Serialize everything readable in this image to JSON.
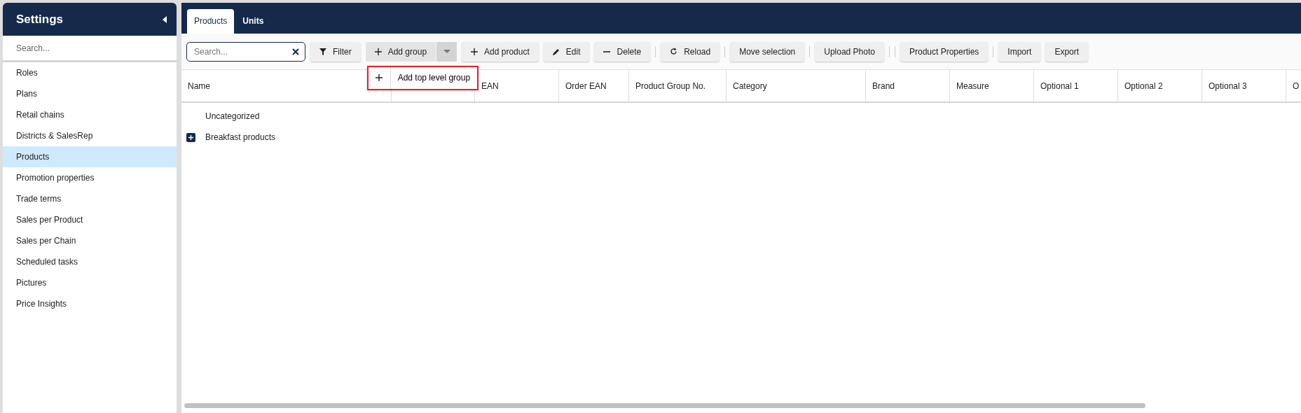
{
  "sidebar": {
    "title": "Settings",
    "search": {
      "placeholder": "Search..."
    },
    "items": [
      {
        "label": "Roles",
        "selected": false
      },
      {
        "label": "Plans",
        "selected": false
      },
      {
        "label": "Retail chains",
        "selected": false
      },
      {
        "label": "Districts & SalesRep",
        "selected": false
      },
      {
        "label": "Products",
        "selected": true
      },
      {
        "label": "Promotion properties",
        "selected": false
      },
      {
        "label": "Trade terms",
        "selected": false
      },
      {
        "label": "Sales per Product",
        "selected": false
      },
      {
        "label": "Sales per Chain",
        "selected": false
      },
      {
        "label": "Scheduled tasks",
        "selected": false
      },
      {
        "label": "Pictures",
        "selected": false
      },
      {
        "label": "Price Insights",
        "selected": false
      }
    ]
  },
  "tabs": [
    {
      "label": "Products",
      "selected": true
    },
    {
      "label": "Units",
      "selected": false
    }
  ],
  "toolbar": {
    "search": {
      "placeholder": "Search..."
    },
    "items": [
      {
        "kind": "button",
        "label": "Filter"
      },
      {
        "kind": "split",
        "label": "Add group",
        "expanded": true,
        "menu": [
          {
            "label": "Add top level group"
          }
        ]
      },
      {
        "kind": "button",
        "label": "Add product"
      },
      {
        "kind": "button",
        "label": "Edit"
      },
      {
        "kind": "button",
        "label": "Delete"
      },
      {
        "kind": "separator"
      },
      {
        "kind": "button",
        "label": "Reload"
      },
      {
        "kind": "separator"
      },
      {
        "kind": "button",
        "label": "Move selection"
      },
      {
        "kind": "separator"
      },
      {
        "kind": "button",
        "label": "Upload Photo"
      },
      {
        "kind": "separator"
      },
      {
        "kind": "separator"
      },
      {
        "kind": "button",
        "label": "Product Properties"
      },
      {
        "kind": "separator"
      },
      {
        "kind": "button",
        "label": "Import"
      },
      {
        "kind": "button",
        "label": "Export"
      }
    ]
  },
  "table": {
    "columns": [
      "Name",
      "",
      "EAN",
      "Order EAN",
      "Product Group No.",
      "Category",
      "Brand",
      "Measure",
      "Optional 1",
      "Optional 2",
      "Optional 3",
      "O"
    ],
    "rows": [
      {
        "kind": "leaf",
        "name": "Uncategorized"
      },
      {
        "kind": "group",
        "name": "Breakfast products",
        "expanded": false
      }
    ]
  }
}
